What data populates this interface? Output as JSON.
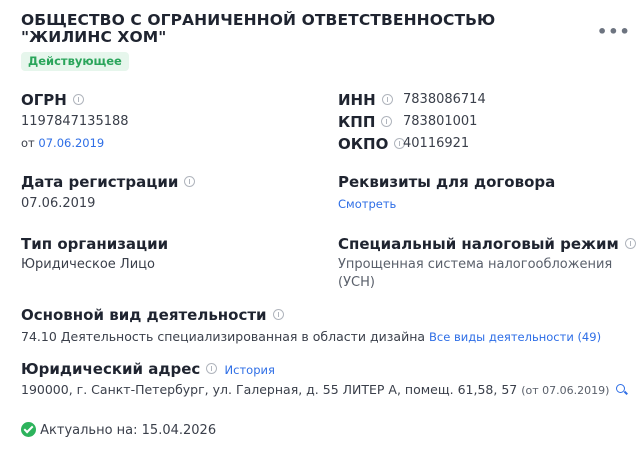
{
  "company": {
    "name_line1": "ОБЩЕСТВО С ОГРАНИЧЕННОЙ ОТВЕТСТВЕННОСТЬЮ",
    "name_line2": "\"ЖИЛИНС ХОМ\"",
    "status": "Действующее"
  },
  "ogrn": {
    "label": "ОГРН",
    "value": "1197847135188",
    "from_prefix": "от",
    "from_date": "07.06.2019"
  },
  "inn": {
    "label": "ИНН",
    "value": "7838086714"
  },
  "kpp": {
    "label": "КПП",
    "value": "783801001"
  },
  "okpo": {
    "label": "ОКПО",
    "value": "40116921"
  },
  "registration": {
    "label": "Дата регистрации",
    "value": "07.06.2019"
  },
  "requisites": {
    "label": "Реквизиты для договора",
    "link": "Смотреть"
  },
  "org_type": {
    "label": "Тип организации",
    "value": "Юридическое Лицо"
  },
  "tax_regime": {
    "label": "Специальный налоговый режим",
    "line1": "Упрощенная система налогообложения",
    "line2": "(УСН)"
  },
  "activity": {
    "label": "Основной вид деятельности",
    "value": "74.10 Деятельность специализированная в области дизайна",
    "link": "Все виды деятельности (49)"
  },
  "address": {
    "label": "Юридический адрес",
    "history_link": "История",
    "value": "190000, г. Санкт-Петербург, ул. Галерная, д. 55 ЛИТЕР А, помещ. 61,58, 57",
    "since": "(от 07.06.2019)"
  },
  "actual": {
    "text": "Актуально на: 15.04.2026"
  },
  "colors": {
    "accent": "#2e6ee6",
    "success": "#2db35c",
    "badge_bg": "#e6f6ec"
  }
}
